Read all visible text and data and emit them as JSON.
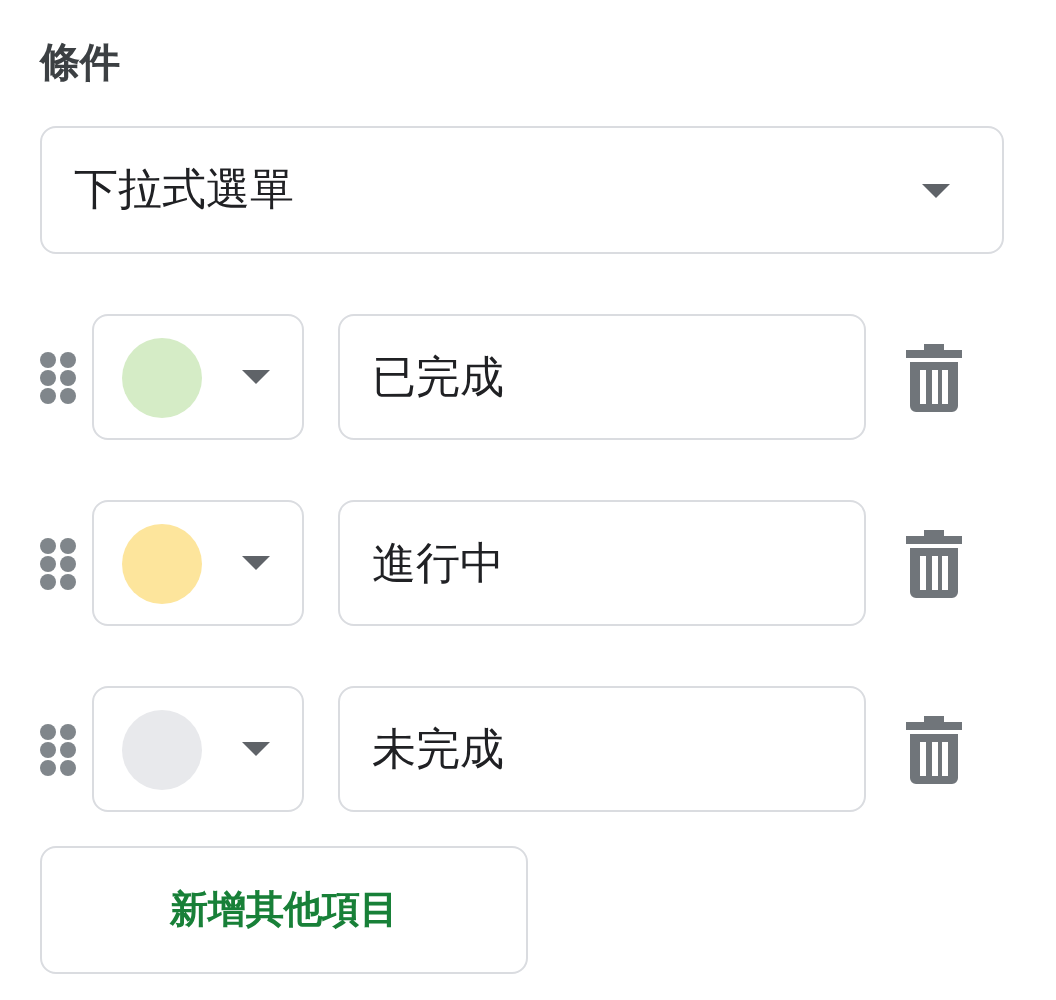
{
  "section_label": "條件",
  "criteria": {
    "value": "下拉式選單"
  },
  "items": [
    {
      "color": "#d5ecc6",
      "value": "已完成"
    },
    {
      "color": "#fde59c",
      "value": "進行中"
    },
    {
      "color": "#e8e9ec",
      "value": "未完成"
    }
  ],
  "add_button": "新增其他項目"
}
